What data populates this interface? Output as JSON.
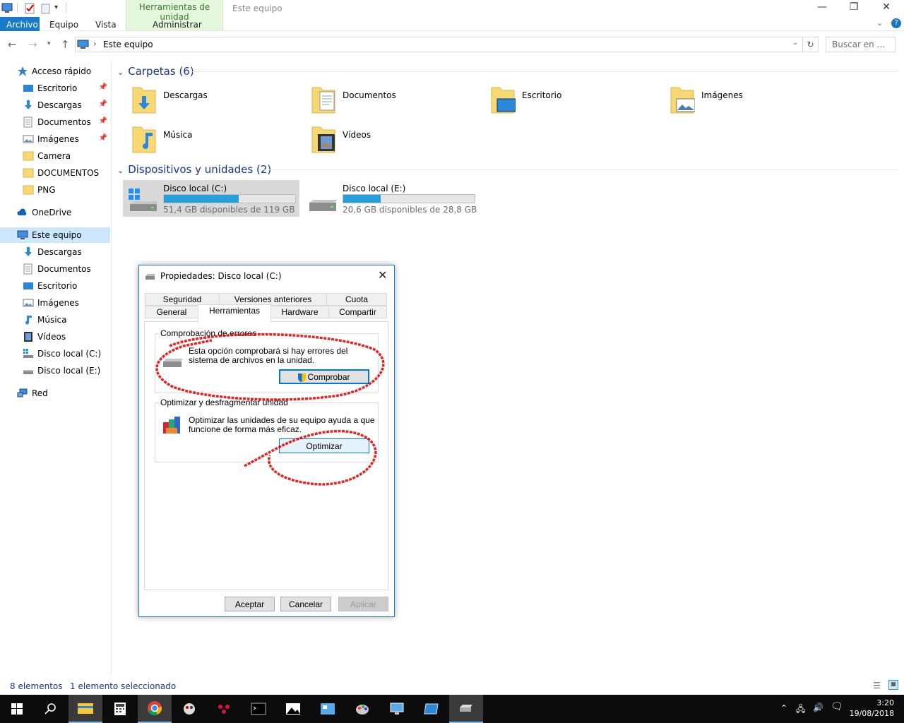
{
  "window": {
    "title": "Este equipo",
    "context_tab_group": "Herramientas de unidad",
    "controls": {
      "minimize": "—",
      "maximize": "❐",
      "close": "✕"
    }
  },
  "ribbon": {
    "tabs": [
      "Archivo",
      "Equipo",
      "Vista"
    ],
    "context_tab": "Administrar",
    "expand_icon": "chevron-down-icon",
    "help_icon": "help-icon"
  },
  "address": {
    "breadcrumb": "Este equipo",
    "search_placeholder": "Buscar en ...",
    "refresh_icon": "refresh-icon"
  },
  "nav": {
    "quick_access": "Acceso rápido",
    "quick_items": [
      {
        "label": "Escritorio",
        "pinned": true
      },
      {
        "label": "Descargas",
        "pinned": true
      },
      {
        "label": "Documentos",
        "pinned": true
      },
      {
        "label": "Imágenes",
        "pinned": true
      },
      {
        "label": "Camera",
        "pinned": false
      },
      {
        "label": "DOCUMENTOS",
        "pinned": false
      },
      {
        "label": "PNG",
        "pinned": false
      }
    ],
    "onedrive": "OneDrive",
    "this_pc": "Este equipo",
    "pc_items": [
      "Descargas",
      "Documentos",
      "Escritorio",
      "Imágenes",
      "Música",
      "Vídeos",
      "Disco local (C:)",
      "Disco local (E:)"
    ],
    "network": "Red"
  },
  "folders": {
    "header": "Carpetas (6)",
    "items": [
      "Descargas",
      "Documentos",
      "Escritorio",
      "Imágenes",
      "Música",
      "Vídeos"
    ]
  },
  "devices": {
    "header": "Dispositivos y unidades (2)",
    "items": [
      {
        "name": "Disco local (C:)",
        "free": "51,4 GB disponibles de 119 GB",
        "used_fraction": 0.568
      },
      {
        "name": "Disco local (E:)",
        "free": "20,6 GB disponibles de 28,8 GB",
        "used_fraction": 0.285
      }
    ]
  },
  "status": {
    "count": "8 elementos",
    "selected": "1 elemento seleccionado"
  },
  "dialog": {
    "title": "Propiedades: Disco local (C:)",
    "tabs_back": [
      "Seguridad",
      "Versiones anteriores",
      "Cuota"
    ],
    "tabs_front": [
      "General",
      "Herramientas",
      "Hardware",
      "Compartir"
    ],
    "active_tab": "Herramientas",
    "error_check": {
      "title": "Comprobación de errores",
      "line1": "Esta opción comprobará si hay errores del",
      "line2": "sistema de archivos en la unidad.",
      "button": "Comprobar"
    },
    "optimize": {
      "title": "Optimizar y desfragmentar unidad",
      "line1": "Optimizar las unidades de su equipo ayuda a que",
      "line2": "funcione de forma más eficaz.",
      "button": "Optimizar"
    },
    "buttons": {
      "ok": "Aceptar",
      "cancel": "Cancelar",
      "apply": "Aplicar"
    }
  },
  "taskbar": {
    "time": "3:20",
    "date": "19/08/2018",
    "apps": [
      "file-explorer",
      "calculator",
      "chrome",
      "paint-tool",
      "app-red",
      "terminal",
      "photos",
      "control-panel",
      "paint",
      "remote-desktop",
      "window-app",
      "drive-app"
    ]
  },
  "colors": {
    "accent": "#1979ca",
    "folder_header": "#1e3287",
    "drive_fill": "#26a0da",
    "context_tab": "#e4f7dd",
    "annotation": "#dd0000"
  }
}
